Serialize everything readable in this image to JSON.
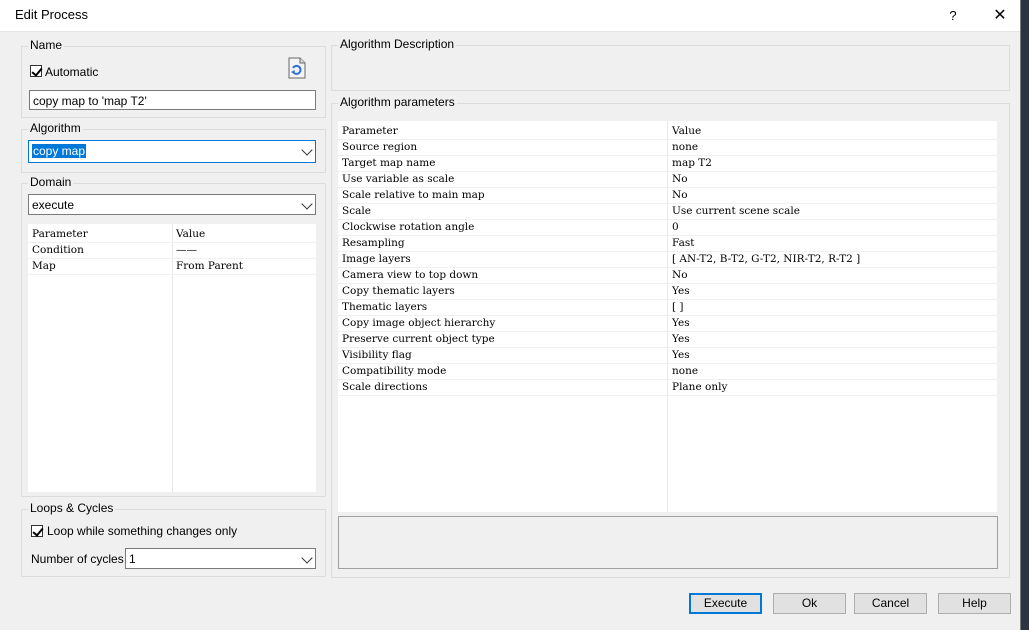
{
  "window": {
    "title": "Edit Process",
    "help_label": "?",
    "close_label": "✕"
  },
  "name_group": {
    "legend": "Name",
    "automatic_label": "Automatic",
    "automatic_checked": true,
    "name_value": "copy map to 'map T2'"
  },
  "algorithm_group": {
    "legend": "Algorithm",
    "selected": "copy map"
  },
  "domain_group": {
    "legend": "Domain",
    "selected": "execute",
    "header": {
      "param": "Parameter",
      "value": "Value"
    },
    "rows": [
      {
        "param": "Condition",
        "value": "——"
      },
      {
        "param": "Map",
        "value": "From Parent"
      }
    ]
  },
  "loops_group": {
    "legend": "Loops & Cycles",
    "loop_label": "Loop while something changes only",
    "loop_checked": true,
    "cycles_label": "Number of cycles",
    "cycles_value": "1"
  },
  "description_group": {
    "legend": "Algorithm Description"
  },
  "params_group": {
    "legend": "Algorithm parameters",
    "header": {
      "param": "Parameter",
      "value": "Value"
    },
    "rows": [
      {
        "param": "Source region",
        "value": "none"
      },
      {
        "param": "Target map name",
        "value": "map T2"
      },
      {
        "param": "Use variable as scale",
        "value": "No"
      },
      {
        "param": "Scale relative to main map",
        "value": "No"
      },
      {
        "param": "Scale",
        "value": "Use current scene scale"
      },
      {
        "param": "Clockwise rotation angle",
        "value": "0"
      },
      {
        "param": "Resampling",
        "value": "Fast"
      },
      {
        "param": "Image layers",
        "value": "[ AN-T2, B-T2, G-T2, NIR-T2, R-T2 ]"
      },
      {
        "param": "Camera view to top down",
        "value": "No"
      },
      {
        "param": "Copy thematic layers",
        "value": "Yes"
      },
      {
        "param": "Thematic layers",
        "value": "[  ]"
      },
      {
        "param": "Copy image object hierarchy",
        "value": "Yes"
      },
      {
        "param": "Preserve current object type",
        "value": "Yes"
      },
      {
        "param": "Visibility flag",
        "value": "Yes"
      },
      {
        "param": "Compatibility mode",
        "value": "none"
      },
      {
        "param": "Scale directions",
        "value": "Plane only"
      }
    ]
  },
  "buttons": {
    "execute": "Execute",
    "ok": "Ok",
    "cancel": "Cancel",
    "help": "Help"
  },
  "colors": {
    "accent": "#0078d7",
    "dialog_bg": "#f0f0f0"
  }
}
